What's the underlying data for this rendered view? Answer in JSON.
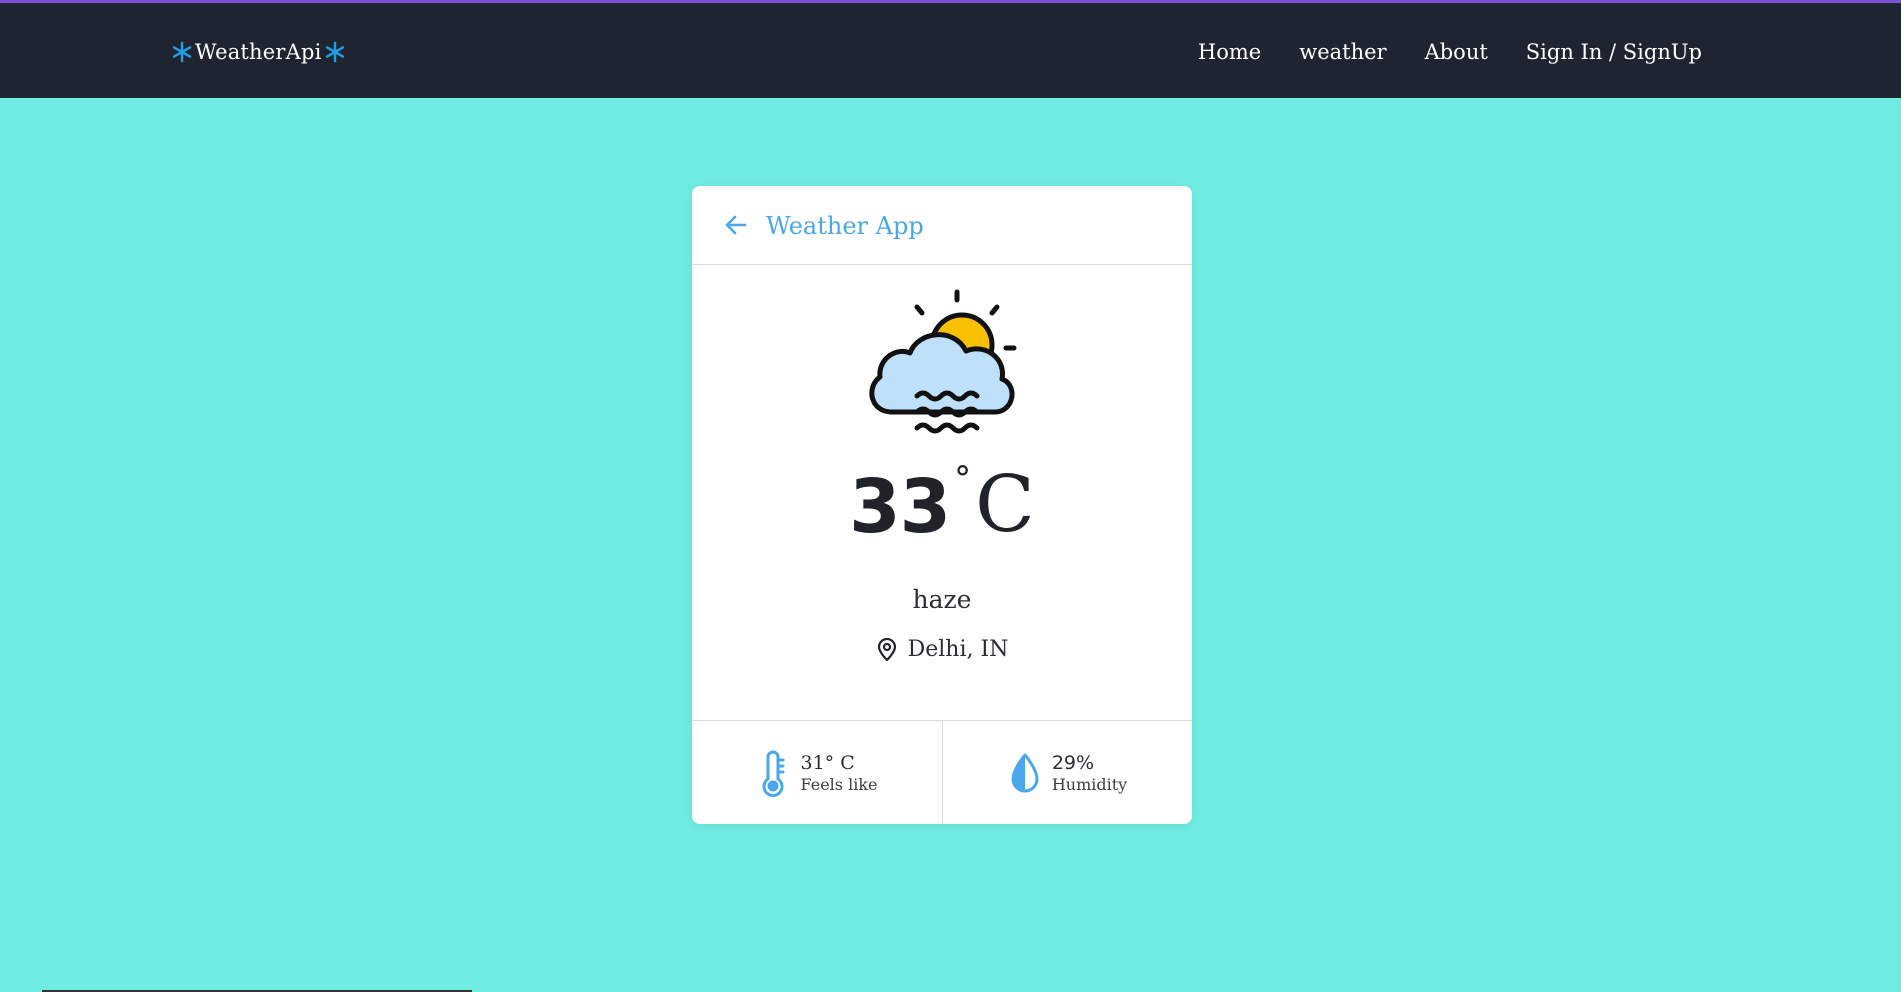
{
  "navbar": {
    "brand": "WeatherApi",
    "links": [
      {
        "label": "Home"
      },
      {
        "label": "weather"
      },
      {
        "label": "About"
      },
      {
        "label": "Sign In / SignUp"
      }
    ]
  },
  "card": {
    "header_title": "Weather App",
    "temperature": "33",
    "degree_symbol": "°",
    "unit": "C",
    "condition": "haze",
    "location": "Delhi, IN",
    "feels_like": {
      "value": "31° C",
      "label": "Feels like"
    },
    "humidity": {
      "value": "29%",
      "label": "Humidity"
    }
  },
  "colors": {
    "page_background": "#6fece2",
    "navbar_background": "#1f2530",
    "accent": "#4aa7ec",
    "sun": "#f9c000",
    "cloud": "#bfe0fb"
  },
  "icons": {
    "brand": "snowflake-icon",
    "back": "arrow-left-icon",
    "weather": "haze-cloud-sun-icon",
    "location": "map-pin-icon",
    "feels_like": "thermometer-icon",
    "humidity": "water-drop-icon"
  }
}
